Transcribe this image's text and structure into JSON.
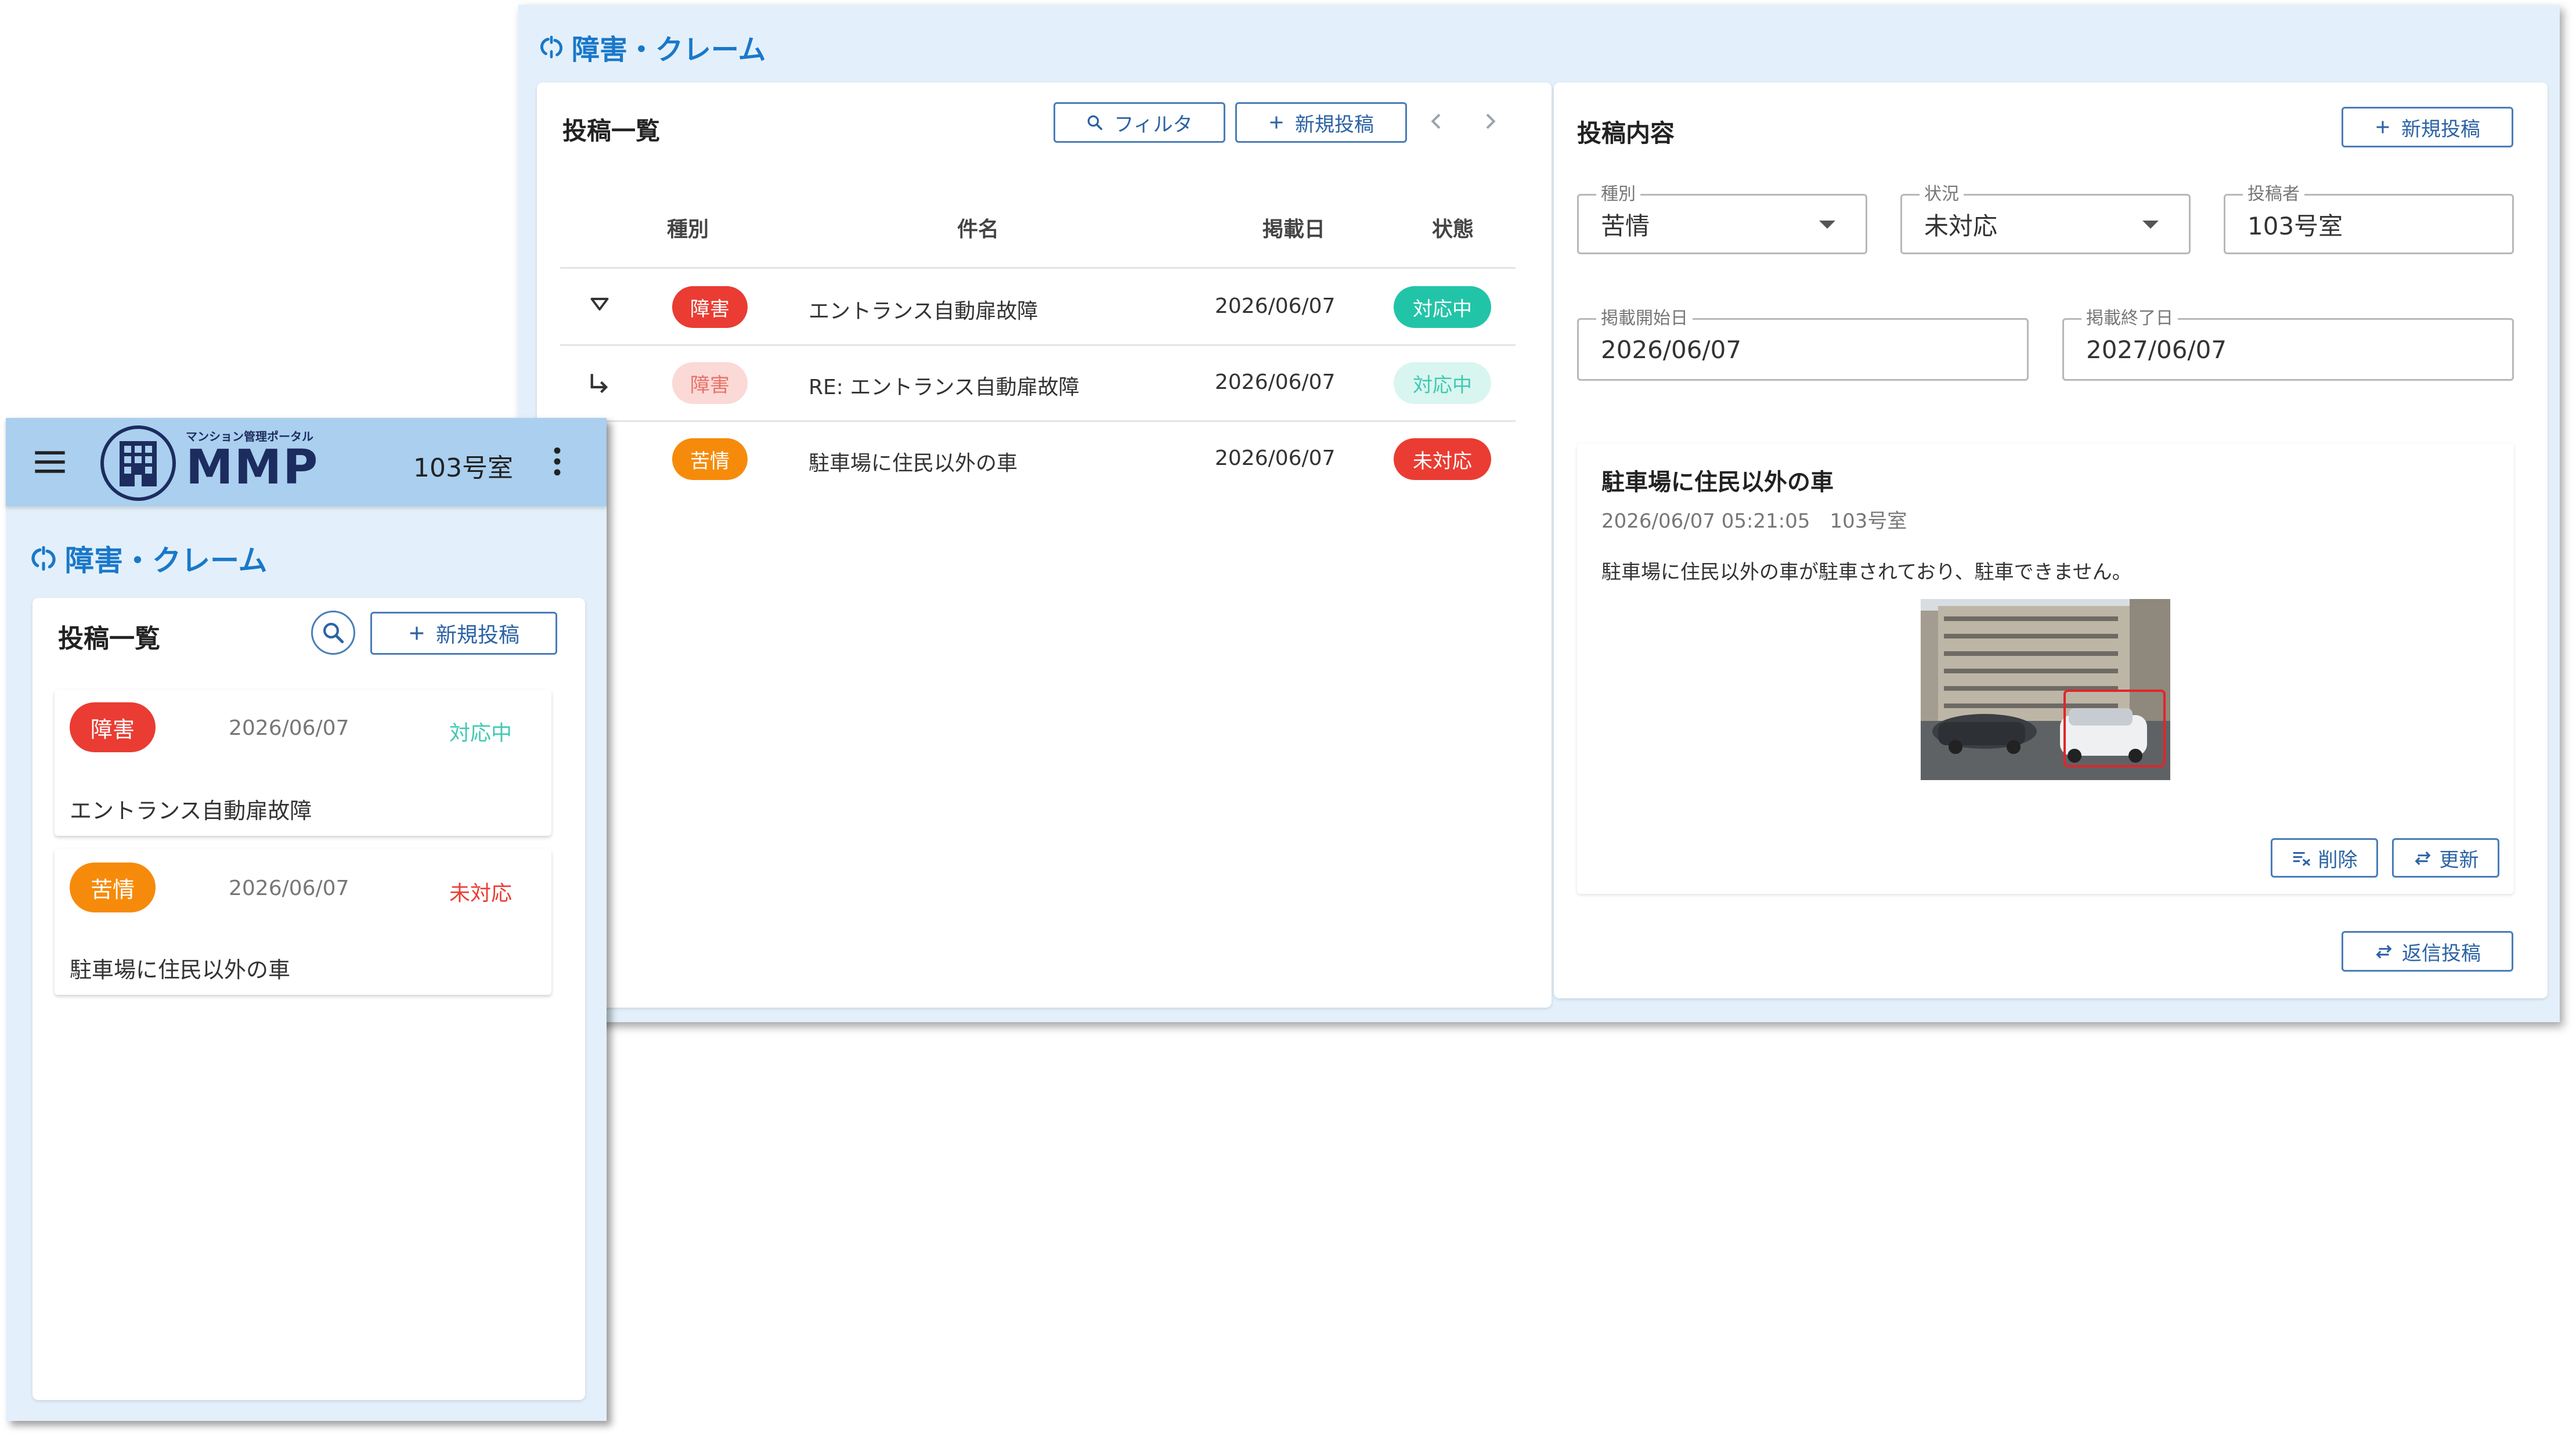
{
  "desktop": {
    "page_title": "障害・クレーム",
    "list": {
      "title": "投稿一覧",
      "filter_label": "フィルタ",
      "new_post_label": "新規投稿",
      "prev_icon": "chevron-left-icon",
      "next_icon": "chevron-right-icon",
      "columns": [
        "種別",
        "件名",
        "掲載日",
        "状態"
      ],
      "rows": [
        {
          "indicator": "expand-down-icon",
          "type": "障害",
          "subject": "エントランス自動扉故障",
          "date": "2026/06/07",
          "status": "対応中"
        },
        {
          "indicator": "reply-arrow-icon",
          "type": "障害",
          "subject": "RE: エントランス自動扉故障",
          "date": "2026/06/07",
          "status": "対応中"
        },
        {
          "indicator": "",
          "type": "苦情",
          "subject": "駐車場に住民以外の車",
          "date": "2026/06/07",
          "status": "未対応"
        }
      ]
    },
    "detail": {
      "title": "投稿内容",
      "new_post_label": "新規投稿",
      "fields": {
        "type_label": "種別",
        "type_value": "苦情",
        "status_label": "状況",
        "status_value": "未対応",
        "poster_label": "投稿者",
        "poster_value": "103号室",
        "start_label": "掲載開始日",
        "start_value": "2026/06/07",
        "end_label": "掲載終了日",
        "end_value": "2027/06/07"
      },
      "post": {
        "title": "駐車場に住民以外の車",
        "meta": "2026/06/07 05:21:05　103号室",
        "body": "駐車場に住民以外の車が駐車されており、駐車できません。",
        "delete_label": "削除",
        "update_label": "更新"
      },
      "reply_label": "返信投稿"
    }
  },
  "mobile": {
    "logo_caption": "マンション管理ポータル",
    "logo_text": "MMP",
    "room": "103号室",
    "page_title": "障害・クレーム",
    "list_title": "投稿一覧",
    "new_post_label": "新規投稿",
    "items": [
      {
        "type": "障害",
        "date": "2026/06/07",
        "status": "対応中",
        "subject": "エントランス自動扉故障"
      },
      {
        "type": "苦情",
        "date": "2026/06/07",
        "status": "未対応",
        "subject": "駐車場に住民以外の車"
      }
    ]
  },
  "colors": {
    "accent": "#1a78c9",
    "fault": "#ea3c33",
    "complaint": "#f68b0b",
    "in_progress": "#22c4a8",
    "not_handled": "#ea3c33",
    "panel_bg": "#e3f0fb"
  }
}
